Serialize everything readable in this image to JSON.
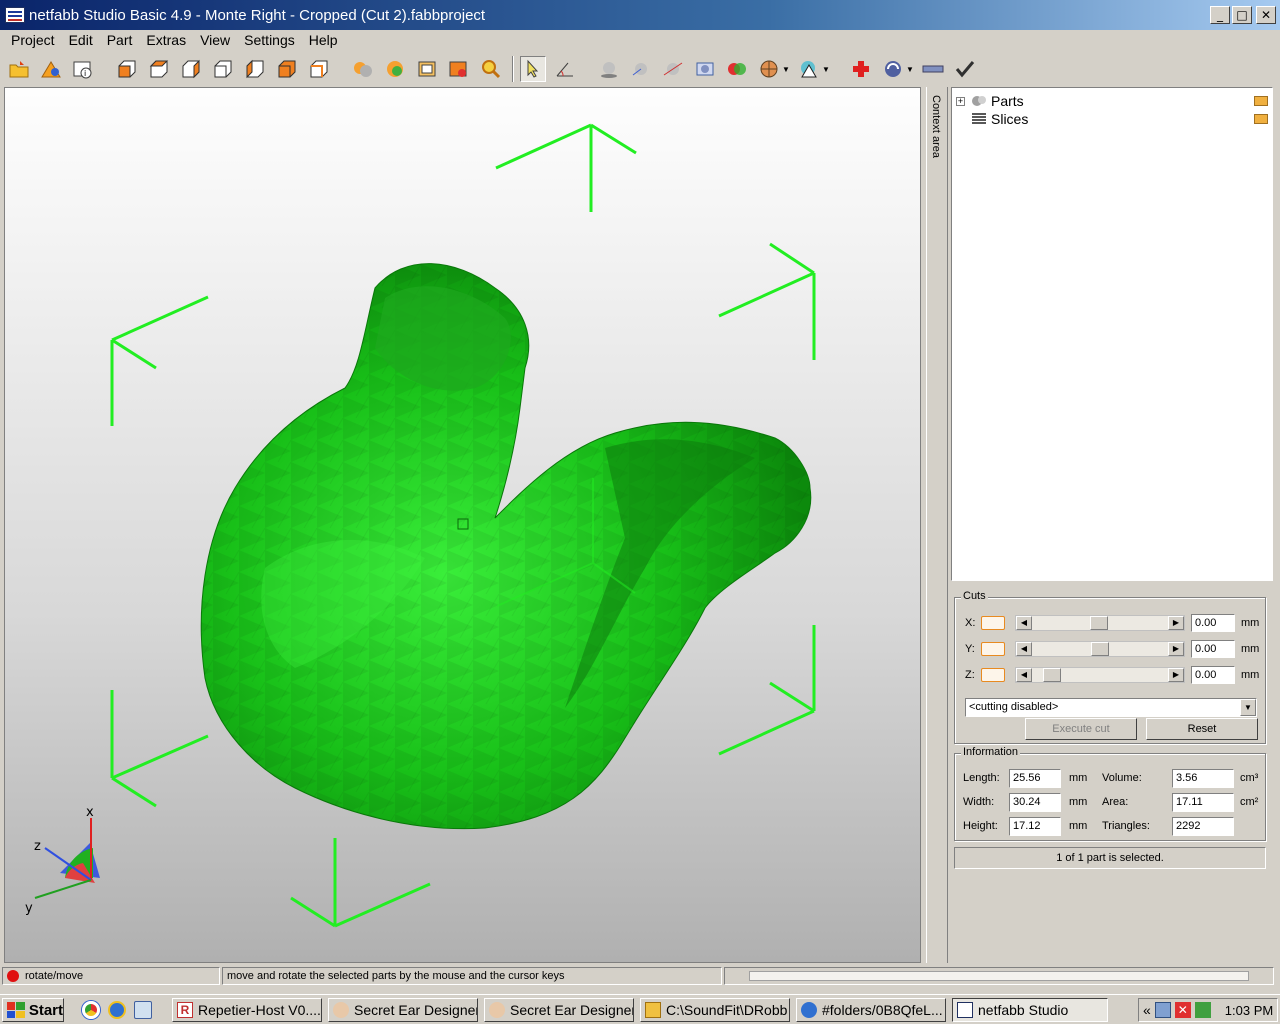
{
  "window": {
    "title": "netfabb Studio Basic 4.9 - Monte Right - Cropped (Cut 2).fabbproject",
    "minimize_label": "_",
    "maximize_label": "□",
    "close_label": "✕"
  },
  "menu": {
    "items": [
      "Project",
      "Edit",
      "Part",
      "Extras",
      "View",
      "Settings",
      "Help"
    ]
  },
  "viewport": {
    "axes": {
      "x": "x",
      "y": "y",
      "z": "z"
    },
    "model_color": "#22cc22",
    "bracket_color": "#22ee22"
  },
  "context_area": {
    "label": "Context area"
  },
  "tree": {
    "items": [
      {
        "label": "Parts",
        "expand": "+"
      },
      {
        "label": "Slices",
        "expand": ""
      }
    ]
  },
  "cuts": {
    "title": "Cuts",
    "rows": [
      {
        "axis": "X:",
        "value": "0.00",
        "unit": "mm",
        "position": 0.48
      },
      {
        "axis": "Y:",
        "value": "0.00",
        "unit": "mm",
        "position": 0.49
      },
      {
        "axis": "Z:",
        "value": "0.00",
        "unit": "mm",
        "position": 0.09
      }
    ],
    "mode": "<cutting disabled>",
    "execute_label": "Execute cut",
    "reset_label": "Reset"
  },
  "information": {
    "title": "Information",
    "length_label": "Length:",
    "length": "25.56",
    "length_unit": "mm",
    "width_label": "Width:",
    "width": "30.24",
    "width_unit": "mm",
    "height_label": "Height:",
    "height": "17.12",
    "height_unit": "mm",
    "volume_label": "Volume:",
    "volume": "3.56",
    "volume_unit": "cm³",
    "area_label": "Area:",
    "area": "17.11",
    "area_unit": "cm²",
    "triangles_label": "Triangles:",
    "triangles": "2292"
  },
  "selection_status": "1 of 1 part is selected.",
  "statusbar": {
    "mode": "rotate/move",
    "hint": "move and rotate the selected parts by the mouse and the cursor keys"
  },
  "taskbar": {
    "start_label": "Start",
    "tasks": [
      {
        "label": "Repetier-Host V0....",
        "active": false
      },
      {
        "label": "Secret Ear Designer",
        "active": false
      },
      {
        "label": "Secret Ear Designer",
        "active": false
      },
      {
        "label": "C:\\SoundFit\\DRobb",
        "active": false
      },
      {
        "label": "#folders/0B8QfeL...",
        "active": false
      },
      {
        "label": "netfabb Studio",
        "active": true
      }
    ],
    "tray_expand": "«",
    "clock": "1:03 PM"
  }
}
